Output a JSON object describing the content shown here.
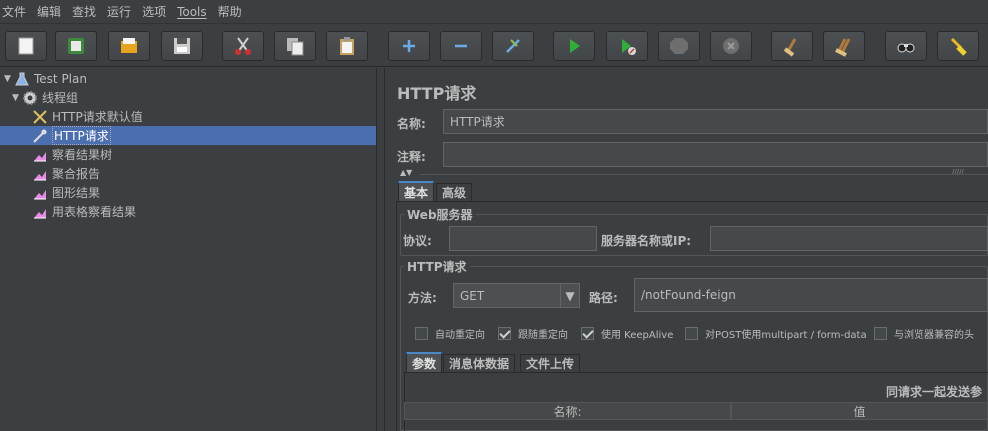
{
  "menu": [
    "文件",
    "编辑",
    "查找",
    "运行",
    "选项",
    "Tools",
    "帮助"
  ],
  "toolbar_icons": [
    "new-icon",
    "templates-icon",
    "open-icon",
    "save-icon",
    "cut-icon",
    "copy-icon",
    "paste-icon",
    "expand-icon",
    "collapse-icon",
    "toggle-icon",
    "start-icon",
    "start-no-pause-icon",
    "stop-icon",
    "shutdown-icon",
    "clear-icon",
    "clear-all-icon",
    "search-icon",
    "reset-search-icon"
  ],
  "tree": {
    "root": "Test Plan",
    "group": "线程组",
    "items": [
      "HTTP请求默认值",
      "HTTP请求",
      "察看结果树",
      "聚合报告",
      "图形结果",
      "用表格察看结果"
    ],
    "selected": "HTTP请求"
  },
  "panel": {
    "title": "HTTP请求",
    "name_label": "名称:",
    "name_value": "HTTP请求",
    "comment_label": "注释:",
    "comment_value": "",
    "tabs": [
      "基本",
      "高级"
    ],
    "web_server_title": "Web服务器",
    "protocol_label": "协议:",
    "protocol_value": "",
    "server_label": "服务器名称或IP:",
    "server_value": "",
    "http_request_title": "HTTP请求",
    "method_label": "方法:",
    "method_value": "GET",
    "path_label": "路径:",
    "path_value": "/notFound-feign",
    "checkboxes": [
      {
        "label": "自动重定向",
        "checked": false
      },
      {
        "label": "跟随重定向",
        "checked": true
      },
      {
        "label": "使用 KeepAlive",
        "checked": true
      },
      {
        "label": "对POST使用multipart / form-data",
        "checked": false
      },
      {
        "label": "与浏览器兼容的头",
        "checked": false
      }
    ],
    "sub_tabs": [
      "参数",
      "消息体数据",
      "文件上传"
    ],
    "params_caption": "同请求一起发送参",
    "table_headers": [
      "名称:",
      "值"
    ]
  }
}
